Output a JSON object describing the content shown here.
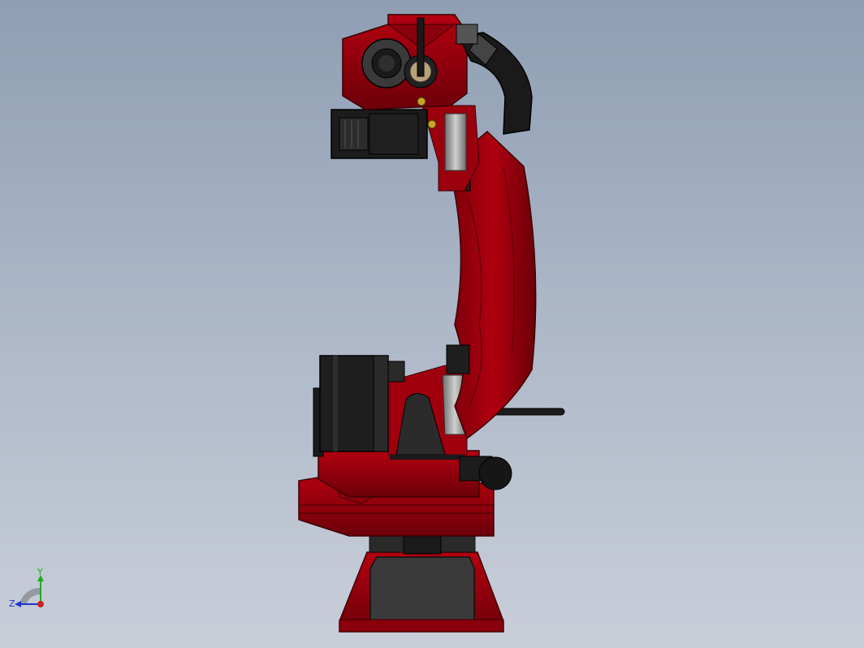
{
  "viewport": {
    "background_top": "#8f9eb3",
    "background_bottom": "#c9cfd9"
  },
  "model": {
    "body_color": "#a3000e",
    "body_shadow": "#5e0008",
    "motor_color": "#1e1e1e",
    "accent_color": "#c9a227"
  },
  "triad": {
    "x_label": "",
    "y_label": "Y",
    "z_label": "Z",
    "y_color": "#22aa22",
    "x_color": "#cc2222",
    "z_color": "#2233cc"
  }
}
